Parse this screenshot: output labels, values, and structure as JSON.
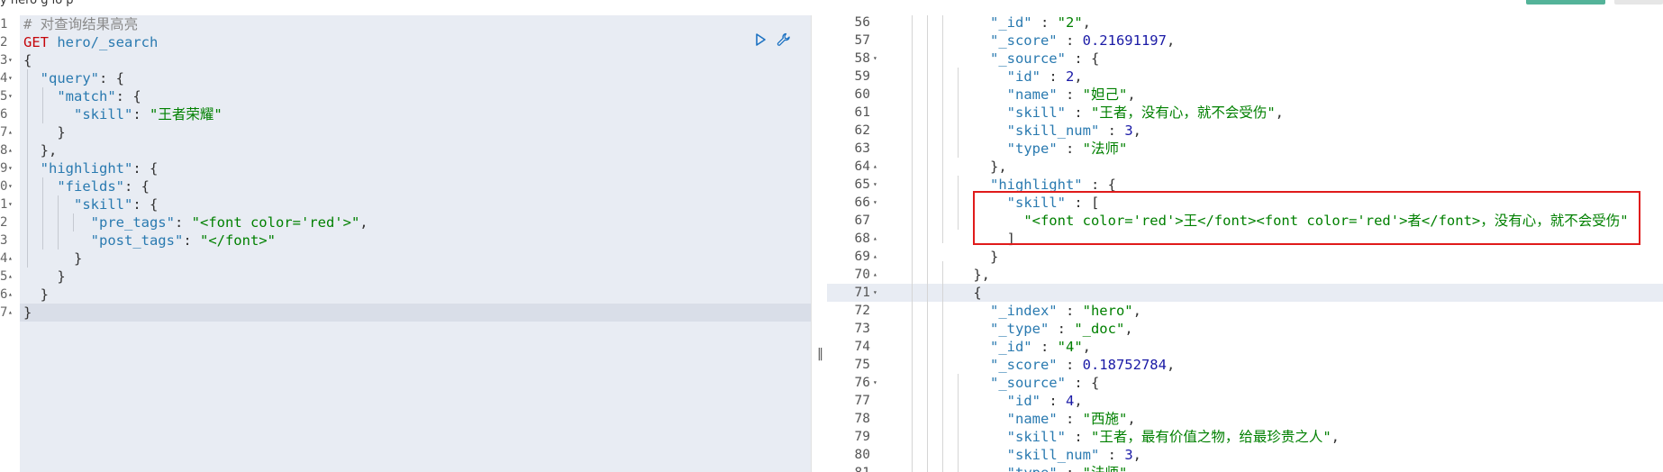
{
  "topbar": {
    "title": "y  hero  g    lo  p"
  },
  "left_editor": {
    "lines": [
      {
        "num": "1",
        "fold": "",
        "tokens": [
          {
            "t": "# 对查询结果高亮",
            "c": "comment"
          }
        ]
      },
      {
        "num": "2",
        "fold": "",
        "tokens": [
          {
            "t": "GET",
            "c": "method"
          },
          {
            "t": " hero/_search",
            "c": "url"
          }
        ]
      },
      {
        "num": "3",
        "fold": "▾",
        "tokens": [
          {
            "t": "{",
            "c": "punc"
          }
        ]
      },
      {
        "num": "4",
        "fold": "▾",
        "tokens": [
          {
            "t": "  ",
            "c": "punc"
          },
          {
            "t": "\"query\"",
            "c": "key"
          },
          {
            "t": ": {",
            "c": "punc"
          }
        ]
      },
      {
        "num": "5",
        "fold": "▾",
        "tokens": [
          {
            "t": "    ",
            "c": "punc"
          },
          {
            "t": "\"match\"",
            "c": "key"
          },
          {
            "t": ": {",
            "c": "punc"
          }
        ]
      },
      {
        "num": "6",
        "fold": "",
        "tokens": [
          {
            "t": "      ",
            "c": "punc"
          },
          {
            "t": "\"skill\"",
            "c": "key"
          },
          {
            "t": ": ",
            "c": "punc"
          },
          {
            "t": "\"王者荣耀\"",
            "c": "str"
          }
        ]
      },
      {
        "num": "7",
        "fold": "▴",
        "tokens": [
          {
            "t": "    }",
            "c": "punc"
          }
        ]
      },
      {
        "num": "8",
        "fold": "▴",
        "tokens": [
          {
            "t": "  },",
            "c": "punc"
          }
        ]
      },
      {
        "num": "9",
        "fold": "▾",
        "tokens": [
          {
            "t": "  ",
            "c": "punc"
          },
          {
            "t": "\"highlight\"",
            "c": "key"
          },
          {
            "t": ": {",
            "c": "punc"
          }
        ]
      },
      {
        "num": "0",
        "fold": "▾",
        "tokens": [
          {
            "t": "    ",
            "c": "punc"
          },
          {
            "t": "\"fields\"",
            "c": "key"
          },
          {
            "t": ": {",
            "c": "punc"
          }
        ]
      },
      {
        "num": "1",
        "fold": "▾",
        "tokens": [
          {
            "t": "      ",
            "c": "punc"
          },
          {
            "t": "\"skill\"",
            "c": "key"
          },
          {
            "t": ": {",
            "c": "punc"
          }
        ]
      },
      {
        "num": "2",
        "fold": "",
        "tokens": [
          {
            "t": "        ",
            "c": "punc"
          },
          {
            "t": "\"pre_tags\"",
            "c": "key"
          },
          {
            "t": ": ",
            "c": "punc"
          },
          {
            "t": "\"<font color='red'>\"",
            "c": "str"
          },
          {
            "t": ",",
            "c": "punc"
          }
        ]
      },
      {
        "num": "3",
        "fold": "",
        "tokens": [
          {
            "t": "        ",
            "c": "punc"
          },
          {
            "t": "\"post_tags\"",
            "c": "key"
          },
          {
            "t": ": ",
            "c": "punc"
          },
          {
            "t": "\"</font>\"",
            "c": "str"
          }
        ]
      },
      {
        "num": "4",
        "fold": "▴",
        "tokens": [
          {
            "t": "      }",
            "c": "punc"
          }
        ]
      },
      {
        "num": "5",
        "fold": "▴",
        "tokens": [
          {
            "t": "    }",
            "c": "punc"
          }
        ]
      },
      {
        "num": "6",
        "fold": "▴",
        "tokens": [
          {
            "t": "  }",
            "c": "punc"
          }
        ]
      },
      {
        "num": "7",
        "fold": "▴",
        "tokens": [
          {
            "t": "}",
            "c": "punc"
          }
        ]
      }
    ],
    "active_line_index": 16
  },
  "right_output": {
    "lines": [
      {
        "num": "56",
        "fold": "",
        "tokens": [
          {
            "t": "            ",
            "c": "punc"
          },
          {
            "t": "\"_id\"",
            "c": "key"
          },
          {
            "t": " : ",
            "c": "punc"
          },
          {
            "t": "\"2\"",
            "c": "str"
          },
          {
            "t": ",",
            "c": "punc"
          }
        ]
      },
      {
        "num": "57",
        "fold": "",
        "tokens": [
          {
            "t": "            ",
            "c": "punc"
          },
          {
            "t": "\"_score\"",
            "c": "key"
          },
          {
            "t": " : ",
            "c": "punc"
          },
          {
            "t": "0.21691197",
            "c": "num"
          },
          {
            "t": ",",
            "c": "punc"
          }
        ]
      },
      {
        "num": "58",
        "fold": "▾",
        "tokens": [
          {
            "t": "            ",
            "c": "punc"
          },
          {
            "t": "\"_source\"",
            "c": "key"
          },
          {
            "t": " : {",
            "c": "punc"
          }
        ]
      },
      {
        "num": "59",
        "fold": "",
        "tokens": [
          {
            "t": "              ",
            "c": "punc"
          },
          {
            "t": "\"id\"",
            "c": "key"
          },
          {
            "t": " : ",
            "c": "punc"
          },
          {
            "t": "2",
            "c": "num"
          },
          {
            "t": ",",
            "c": "punc"
          }
        ]
      },
      {
        "num": "60",
        "fold": "",
        "tokens": [
          {
            "t": "              ",
            "c": "punc"
          },
          {
            "t": "\"name\"",
            "c": "key"
          },
          {
            "t": " : ",
            "c": "punc"
          },
          {
            "t": "\"妲己\"",
            "c": "str"
          },
          {
            "t": ",",
            "c": "punc"
          }
        ]
      },
      {
        "num": "61",
        "fold": "",
        "tokens": [
          {
            "t": "              ",
            "c": "punc"
          },
          {
            "t": "\"skill\"",
            "c": "key"
          },
          {
            "t": " : ",
            "c": "punc"
          },
          {
            "t": "\"王者，没有心，就不会受伤\"",
            "c": "str"
          },
          {
            "t": ",",
            "c": "punc"
          }
        ]
      },
      {
        "num": "62",
        "fold": "",
        "tokens": [
          {
            "t": "              ",
            "c": "punc"
          },
          {
            "t": "\"skill_num\"",
            "c": "key"
          },
          {
            "t": " : ",
            "c": "punc"
          },
          {
            "t": "3",
            "c": "num"
          },
          {
            "t": ",",
            "c": "punc"
          }
        ]
      },
      {
        "num": "63",
        "fold": "",
        "tokens": [
          {
            "t": "              ",
            "c": "punc"
          },
          {
            "t": "\"type\"",
            "c": "key"
          },
          {
            "t": " : ",
            "c": "punc"
          },
          {
            "t": "\"法师\"",
            "c": "str"
          }
        ]
      },
      {
        "num": "64",
        "fold": "▴",
        "tokens": [
          {
            "t": "            },",
            "c": "punc"
          }
        ]
      },
      {
        "num": "65",
        "fold": "▾",
        "tokens": [
          {
            "t": "            ",
            "c": "punc"
          },
          {
            "t": "\"highlight\"",
            "c": "key"
          },
          {
            "t": " : {",
            "c": "punc"
          }
        ]
      },
      {
        "num": "66",
        "fold": "▾",
        "tokens": [
          {
            "t": "              ",
            "c": "punc"
          },
          {
            "t": "\"skill\"",
            "c": "key"
          },
          {
            "t": " : [",
            "c": "punc"
          }
        ]
      },
      {
        "num": "67",
        "fold": "",
        "tokens": [
          {
            "t": "                ",
            "c": "punc"
          },
          {
            "t": "\"<font color='red'>王</font><font color='red'>者</font>，没有心，就不会受伤\"",
            "c": "str"
          }
        ]
      },
      {
        "num": "68",
        "fold": "▴",
        "tokens": [
          {
            "t": "              ]",
            "c": "punc"
          }
        ]
      },
      {
        "num": "69",
        "fold": "▴",
        "tokens": [
          {
            "t": "            }",
            "c": "punc"
          }
        ]
      },
      {
        "num": "70",
        "fold": "▴",
        "tokens": [
          {
            "t": "          },",
            "c": "punc"
          }
        ]
      },
      {
        "num": "71",
        "fold": "▾",
        "tokens": [
          {
            "t": "          {",
            "c": "punc"
          }
        ]
      },
      {
        "num": "72",
        "fold": "",
        "tokens": [
          {
            "t": "            ",
            "c": "punc"
          },
          {
            "t": "\"_index\"",
            "c": "key"
          },
          {
            "t": " : ",
            "c": "punc"
          },
          {
            "t": "\"hero\"",
            "c": "str"
          },
          {
            "t": ",",
            "c": "punc"
          }
        ]
      },
      {
        "num": "73",
        "fold": "",
        "tokens": [
          {
            "t": "            ",
            "c": "punc"
          },
          {
            "t": "\"_type\"",
            "c": "key"
          },
          {
            "t": " : ",
            "c": "punc"
          },
          {
            "t": "\"_doc\"",
            "c": "str"
          },
          {
            "t": ",",
            "c": "punc"
          }
        ]
      },
      {
        "num": "74",
        "fold": "",
        "tokens": [
          {
            "t": "            ",
            "c": "punc"
          },
          {
            "t": "\"_id\"",
            "c": "key"
          },
          {
            "t": " : ",
            "c": "punc"
          },
          {
            "t": "\"4\"",
            "c": "str"
          },
          {
            "t": ",",
            "c": "punc"
          }
        ]
      },
      {
        "num": "75",
        "fold": "",
        "tokens": [
          {
            "t": "            ",
            "c": "punc"
          },
          {
            "t": "\"_score\"",
            "c": "key"
          },
          {
            "t": " : ",
            "c": "punc"
          },
          {
            "t": "0.18752784",
            "c": "num"
          },
          {
            "t": ",",
            "c": "punc"
          }
        ]
      },
      {
        "num": "76",
        "fold": "▾",
        "tokens": [
          {
            "t": "            ",
            "c": "punc"
          },
          {
            "t": "\"_source\"",
            "c": "key"
          },
          {
            "t": " : {",
            "c": "punc"
          }
        ]
      },
      {
        "num": "77",
        "fold": "",
        "tokens": [
          {
            "t": "              ",
            "c": "punc"
          },
          {
            "t": "\"id\"",
            "c": "key"
          },
          {
            "t": " : ",
            "c": "punc"
          },
          {
            "t": "4",
            "c": "num"
          },
          {
            "t": ",",
            "c": "punc"
          }
        ]
      },
      {
        "num": "78",
        "fold": "",
        "tokens": [
          {
            "t": "              ",
            "c": "punc"
          },
          {
            "t": "\"name\"",
            "c": "key"
          },
          {
            "t": " : ",
            "c": "punc"
          },
          {
            "t": "\"西施\"",
            "c": "str"
          },
          {
            "t": ",",
            "c": "punc"
          }
        ]
      },
      {
        "num": "79",
        "fold": "",
        "tokens": [
          {
            "t": "              ",
            "c": "punc"
          },
          {
            "t": "\"skill\"",
            "c": "key"
          },
          {
            "t": " : ",
            "c": "punc"
          },
          {
            "t": "\"王者，最有价值之物，给最珍贵之人\"",
            "c": "str"
          },
          {
            "t": ",",
            "c": "punc"
          }
        ]
      },
      {
        "num": "80",
        "fold": "",
        "tokens": [
          {
            "t": "              ",
            "c": "punc"
          },
          {
            "t": "\"skill_num\"",
            "c": "key"
          },
          {
            "t": " : ",
            "c": "punc"
          },
          {
            "t": "3",
            "c": "num"
          },
          {
            "t": ",",
            "c": "punc"
          }
        ]
      },
      {
        "num": "81",
        "fold": "",
        "tokens": [
          {
            "t": "              ",
            "c": "punc"
          },
          {
            "t": "\"type\"",
            "c": "key"
          },
          {
            "t": " : ",
            "c": "punc"
          },
          {
            "t": "\"法师\"",
            "c": "str"
          }
        ]
      }
    ],
    "active_line_index": 15
  },
  "icons": {
    "run": "play-icon",
    "settings": "wrench-icon",
    "divider": "resize-grip-icon"
  },
  "colors": {
    "method": "#c5060b",
    "key": "#2a7ab0",
    "string": "#008000",
    "number": "#1a1aa6",
    "highlight_box": "#e01b1b"
  }
}
